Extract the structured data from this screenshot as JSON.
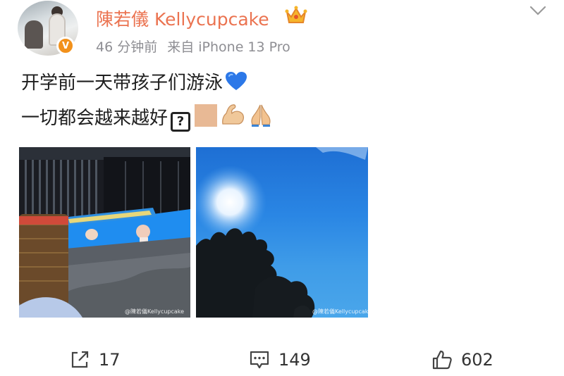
{
  "post": {
    "author": "陳若儀 Kellycupcake",
    "time": "46 分钟前",
    "source": "来自 iPhone 13 Pro",
    "verified_icon": "orange-v-badge",
    "member_icon": "crown-icon",
    "line1": "开学前一天带孩子们游泳",
    "line2": "一切都会越来越好",
    "line1_emoji": "blue-heart-icon",
    "line2_emoji": [
      "unknown-glyph-icon",
      "skin-tone-swatch",
      "flexed-biceps-icon",
      "folded-hands-icon"
    ],
    "unknown_glyph": "?",
    "verified_glyph": "V"
  },
  "photos": [
    {
      "name": "pool-photo",
      "watermark": "@陳若儀Kellycupcake"
    },
    {
      "name": "sky-photo",
      "watermark": "@陳若儀Kellycupcake"
    }
  ],
  "actions": {
    "repost": {
      "icon": "share-icon",
      "count": "17"
    },
    "comment": {
      "icon": "comment-icon",
      "count": "149"
    },
    "like": {
      "icon": "thumbs-up-icon",
      "count": "602"
    }
  },
  "colors": {
    "username": "#eb7350",
    "meta": "#8e8e93",
    "badge": "#f2911b"
  }
}
